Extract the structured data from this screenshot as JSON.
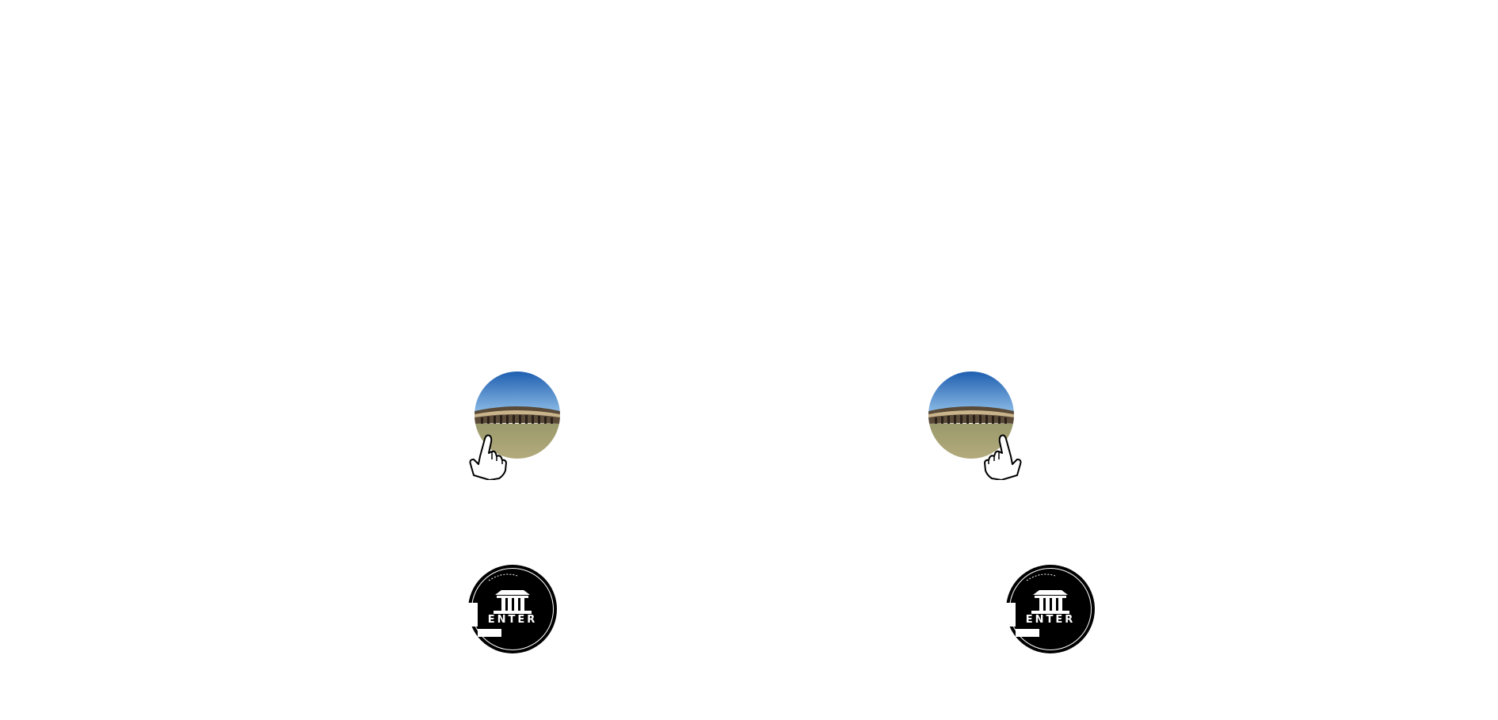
{
  "panels": [
    {
      "pano_thumbnail": {
        "icon": "panorama-thumbnail",
        "hand_side": "left"
      },
      "enter_button": {
        "label": "ENTER",
        "icon": "temple-icon"
      }
    },
    {
      "pano_thumbnail": {
        "icon": "panorama-thumbnail",
        "hand_side": "right"
      },
      "enter_button": {
        "label": "ENTER",
        "icon": "temple-icon"
      }
    }
  ],
  "colors": {
    "background": "#ffffff",
    "sky_top": "#1f5fb0",
    "sky_bottom": "#8fc3ee",
    "ground": "#a9a57a",
    "button": "#000000"
  }
}
